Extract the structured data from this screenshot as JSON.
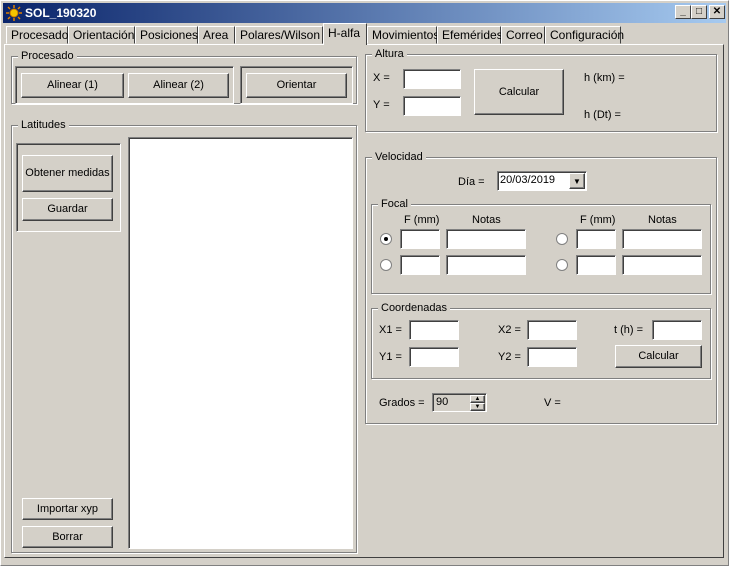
{
  "window": {
    "title": "SOL_190320",
    "min": "_",
    "max": "□",
    "close": "✕"
  },
  "tabs": [
    "Procesado",
    "Orientación",
    "Posiciones",
    "Area",
    "Polares/Wilson",
    "H-alfa",
    "Movimientos",
    "Efemérides",
    "Correo",
    "Configuración"
  ],
  "active_tab": "H-alfa",
  "procesado": {
    "label": "Procesado",
    "align1": "Alinear (1)",
    "align2": "Alinear (2)",
    "orient": "Orientar"
  },
  "latitudes": {
    "label": "Latitudes",
    "obtain": "Obtener medidas",
    "save": "Guardar",
    "import": "Importar xyp",
    "delete": "Borrar"
  },
  "altura": {
    "label": "Altura",
    "x_label": "X =",
    "y_label": "Y =",
    "calc": "Calcular",
    "hkm": "h (km) =",
    "hdt": "h (Dt) ="
  },
  "velocidad": {
    "label": "Velocidad",
    "dia_label": "Día =",
    "dia_value": "20/03/2019",
    "focal": {
      "label": "Focal",
      "f_header": "F (mm)",
      "notas_header": "Notas"
    },
    "coordenadas": {
      "label": "Coordenadas",
      "x1": "X1 =",
      "y1": "Y1 =",
      "x2": "X2 =",
      "y2": "Y2 =",
      "t": "t (h) =",
      "calc": "Calcular"
    },
    "grados_label": "Grados =",
    "grados_value": "90",
    "v_label": "V ="
  }
}
